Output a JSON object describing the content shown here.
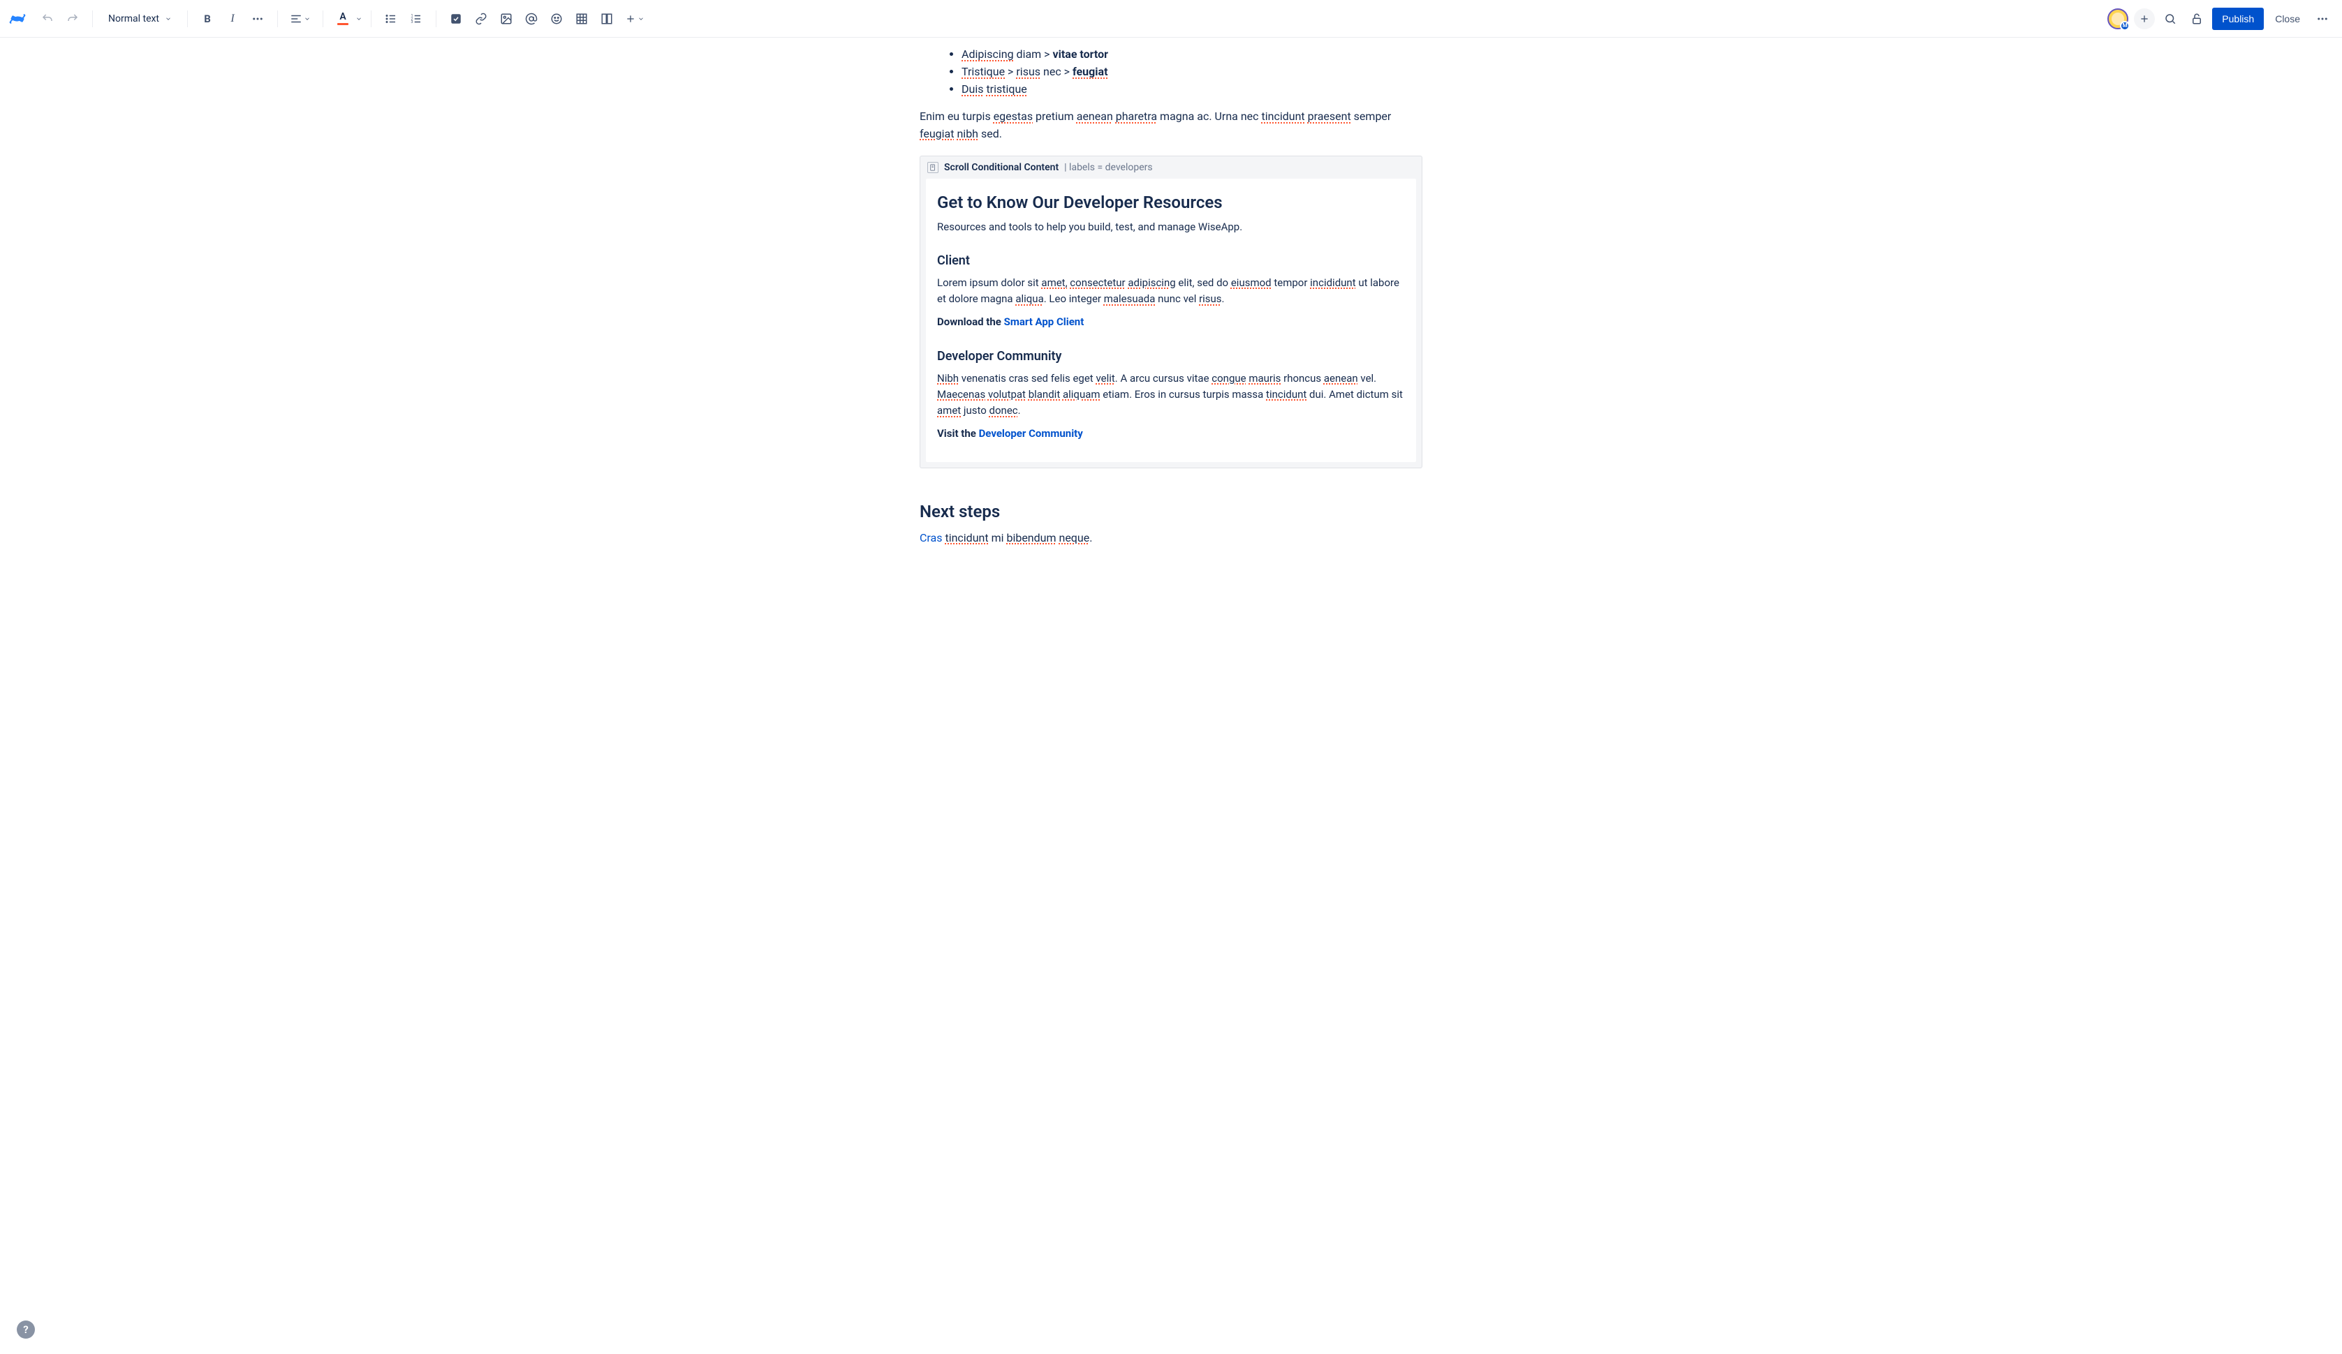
{
  "toolbar": {
    "text_style": "Normal text",
    "publish_label": "Publish",
    "close_label": "Close",
    "avatar_badge": "M"
  },
  "content": {
    "list": [
      {
        "prefix": "Adipiscing",
        "mid": " diam > ",
        "bold": "vitae tortor"
      },
      {
        "prefix": "Tristique",
        "mid": " > ",
        "sp2": "risus",
        "mid2": " nec > ",
        "bold": "feugiat"
      },
      {
        "prefix": "Duis",
        "mid": " ",
        "sp2": "tristique"
      }
    ],
    "para1_parts": [
      "Enim eu turpis ",
      "egestas",
      " pretium ",
      "aenean",
      " ",
      "pharetra",
      " magna ac. Urna nec ",
      "tincidunt",
      " ",
      "praesent",
      " semper ",
      "feugiat",
      " ",
      "nibh",
      " sed."
    ],
    "macro": {
      "name": "Scroll Conditional Content",
      "params": "| labels = developers",
      "h2": "Get to Know Our Developer Resources",
      "intro": "Resources and tools to help you build, test, and manage WiseApp.",
      "h3a": "Client",
      "pa_parts": [
        "Lorem ipsum dolor sit ",
        "amet,",
        " ",
        "consectetur",
        " ",
        "adipiscing",
        " elit, sed do ",
        "eiusmod",
        " tempor ",
        "incididunt",
        " ut labore et dolore magna ",
        "aliqua",
        ". Leo integer ",
        "malesuada",
        " nunc vel ",
        "risus",
        "."
      ],
      "download_prefix": "Download the ",
      "download_link": "Smart App Client",
      "h3b": "Developer Community",
      "pb_parts": [
        "Nibh",
        " venenatis cras sed felis eget ",
        "velit",
        ". A arcu cursus vitae ",
        "congue",
        " ",
        "mauris",
        " rhoncus ",
        "aenean",
        " vel. ",
        "Maecenas",
        " ",
        "volutpat",
        " ",
        "blandit",
        " ",
        "aliquam",
        " etiam. Eros in cursus turpis massa ",
        "tincidunt",
        " dui. Amet dictum sit ",
        "amet",
        " justo ",
        "donec",
        "."
      ],
      "visit_prefix": "Visit the ",
      "visit_link": "Developer Community"
    },
    "next_heading": "Next steps",
    "next_para_parts": [
      "Cras",
      " ",
      "tincidunt",
      " mi ",
      "bibendum",
      " ",
      "neque",
      "."
    ]
  },
  "help": "?"
}
